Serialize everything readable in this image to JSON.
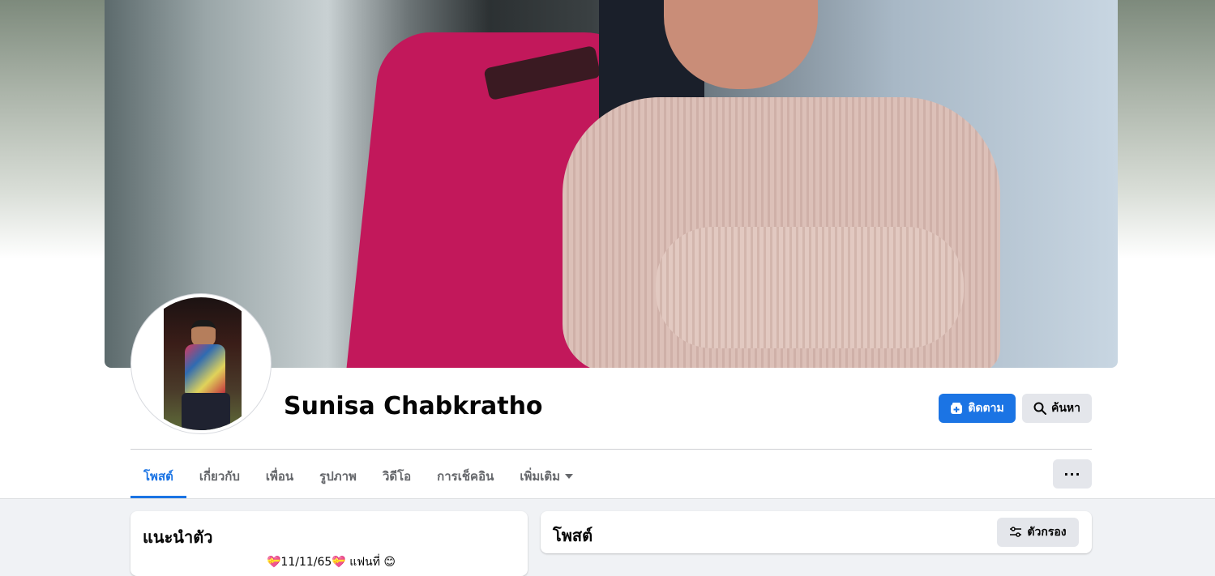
{
  "profile": {
    "name": "Sunisa Chabkratho"
  },
  "actions": {
    "follow_label": "ติดตาม",
    "search_label": "ค้นหา",
    "more_label": "···"
  },
  "tabs": [
    {
      "label": "โพสต์",
      "active": true
    },
    {
      "label": "เกี่ยวกับ",
      "active": false
    },
    {
      "label": "เพื่อน",
      "active": false
    },
    {
      "label": "รูปภาพ",
      "active": false
    },
    {
      "label": "วิดีโอ",
      "active": false
    },
    {
      "label": "การเช็คอิน",
      "active": false
    },
    {
      "label": "เพิ่มเติม",
      "active": false,
      "dropdown": true
    }
  ],
  "intro": {
    "title": "แนะนำตัว",
    "bio": "💝11/11/65💝 แฟนที่ 😊"
  },
  "posts": {
    "title": "โพสต์",
    "filter_label": "ตัวกรอง"
  },
  "colors": {
    "accent": "#1b74e4",
    "secondary_button": "#e4e6eb",
    "page_background": "#f0f2f5"
  },
  "icons": {
    "follow": "follow-plus-icon",
    "search": "search-icon",
    "filter": "filter-sliders-icon",
    "dropdown": "caret-down-icon",
    "more": "more-dots-icon"
  }
}
